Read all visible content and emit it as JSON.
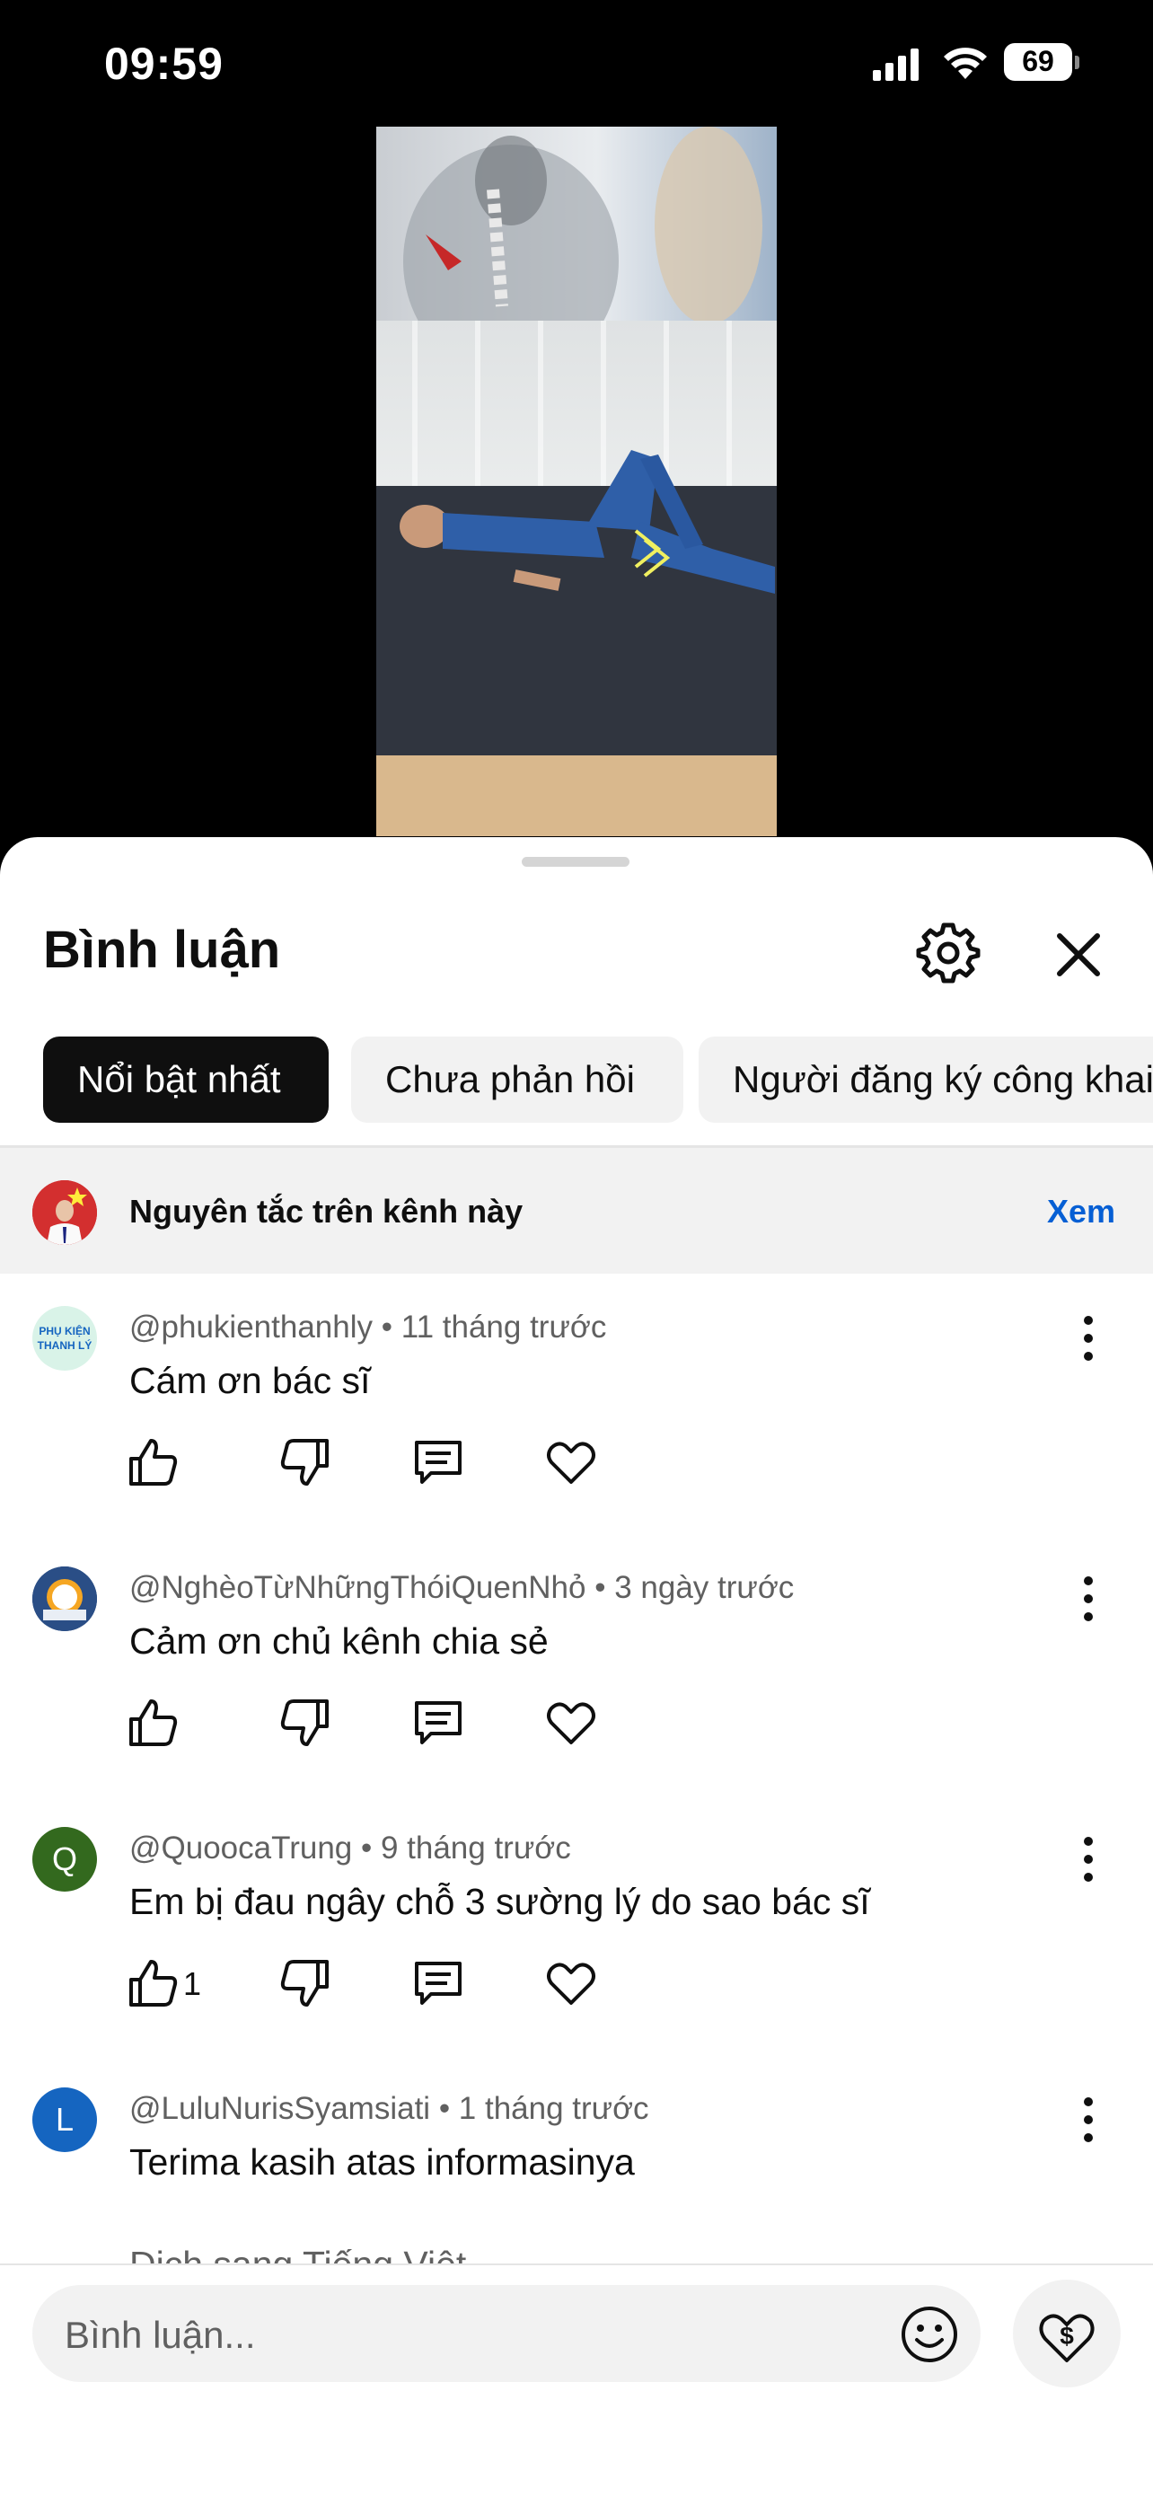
{
  "status_bar": {
    "time": "09:59",
    "battery": "69"
  },
  "sheet": {
    "title": "Bình luận",
    "chips": [
      "Nổi bật nhất",
      "Chưa phản hồi",
      "Người đăng ký công khai"
    ],
    "rules": {
      "label": "Nguyên tắc trên kênh này",
      "see": "Xem"
    }
  },
  "comments": [
    {
      "author": "@phukienthanhly",
      "time": "11 tháng trước",
      "text": "Cám ơn bác sĩ",
      "likes": ""
    },
    {
      "author": "@NghèoTừNhữngThóiQuenNhỏ",
      "time": "3 ngày trước",
      "text": "Cảm ơn chủ kênh chia sẻ",
      "likes": ""
    },
    {
      "author": "@QuoocaTrung",
      "time": "9 tháng trước",
      "text": "Em bị đau ngây chỗ 3 sường lý do sao bác sĩ",
      "likes": "1",
      "initial": "Q"
    },
    {
      "author": "@LuluNurisSyamsiati",
      "time": "1 tháng trước",
      "text": "Terima kasih atas informasinya",
      "likes": "",
      "initial": "L"
    }
  ],
  "translate_label": "Dịch sang Tiếng Việt",
  "composer": {
    "placeholder": "Bình luận..."
  },
  "avatar_texts": {
    "a1_line1": "PHỤ KIỆN",
    "a1_line2": "THANH LÝ"
  },
  "colors": {
    "link": "#065fd4",
    "avatar_q": "#33691e",
    "avatar_l": "#1565c0",
    "chip_active": "#0f0f0f"
  }
}
